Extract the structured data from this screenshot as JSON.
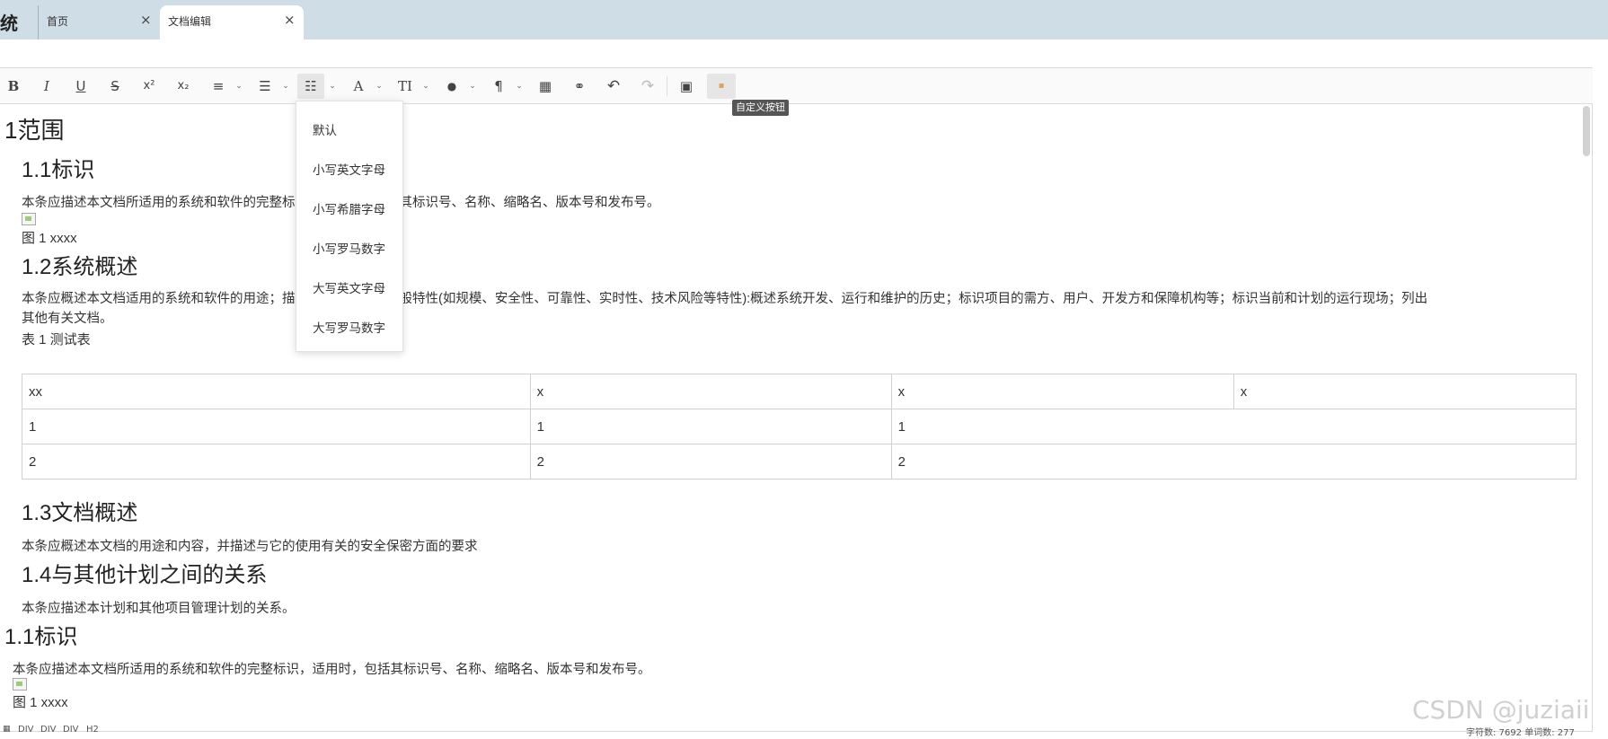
{
  "app": {
    "title_fragment": "统"
  },
  "tabs": [
    {
      "label": "首页",
      "close": "×"
    },
    {
      "label": "文档编辑",
      "close": "×"
    }
  ],
  "toolbar": {
    "bold": "B",
    "italic": "I",
    "underline": "U",
    "strike": "S",
    "superscript": "x²",
    "subscript": "x₂",
    "align": "≡",
    "bullet_list": "☰",
    "numbered_list": "☷",
    "font_color": "A",
    "font_size": "TI",
    "bg_color": "●",
    "paragraph": "¶",
    "table": "▦",
    "link": "⚭",
    "undo": "↶",
    "redo": "↷",
    "image": "▣",
    "custom": "▪",
    "caret": "⌄"
  },
  "tooltip": "自定义按钮",
  "dropdown": {
    "items": [
      "默认",
      "小写英文字母",
      "小写希腊字母",
      "小写罗马数字",
      "大写英文字母",
      "大写罗马数字"
    ]
  },
  "content": {
    "h_scope": "1范围",
    "h_1_1": "1.1标识",
    "p_1_1": "本条应描述本文档所适用的系统和软件的完整标识，适用时，包括其标识号、名称、缩略名、版本号和发布号。",
    "fig_1": "图 1 xxxx",
    "h_1_2": "1.2系统概述",
    "p_1_2_line1": "本条应概述本文档适用的系统和软件的用途；描述系统与软件的一般特性(如规模、安全性、可靠性、实时性、技术风险等特性):概述系统开发、运行和维护的历史；标识项目的需方、用户、开发方和保障机构等；标识当前和计划的运行现场；列出",
    "p_1_2_line2": "其他有关文档。",
    "table_caption": "表 1 测试表",
    "table_rows": [
      [
        "xx",
        "x",
        "x",
        "x"
      ],
      [
        "1",
        "1",
        "1"
      ],
      [
        "2",
        "2",
        "2"
      ]
    ],
    "h_1_3": "1.3文档概述",
    "p_1_3": "本条应概述本文档的用途和内容，并描述与它的使用有关的安全保密方面的要求",
    "h_1_4": "1.4与其他计划之间的关系",
    "p_1_4": "本条应描述本计划和其他项目管理计划的关系。",
    "h_1_1_b": "1.1标识",
    "p_1_1_b": "本条应描述本文档所适用的系统和软件的完整标识，适用时，包括其标识号、名称、缩略名、版本号和发布号。",
    "fig_1_b": "图 1 xxxx"
  },
  "statusbar": {
    "grip": "▦",
    "path": [
      "DIV",
      "DIV",
      "DIV",
      "H2"
    ],
    "counts": "字符数: 7692   单词数: 277"
  },
  "watermark": "CSDN @juziaii"
}
